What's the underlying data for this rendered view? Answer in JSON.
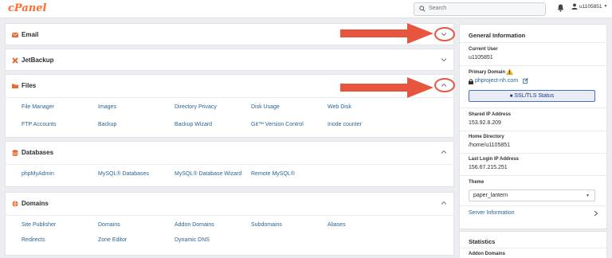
{
  "topbar": {
    "logo": "cPanel",
    "search_placeholder": "Search",
    "username": "u1105851"
  },
  "panels": [
    {
      "title": "Email",
      "icon": "envelope-icon",
      "expanded": false,
      "links": []
    },
    {
      "title": "JetBackup",
      "icon": "jetbackup-icon",
      "expanded": false,
      "links": []
    },
    {
      "title": "Files",
      "icon": "folder-icon",
      "expanded": true,
      "links": [
        "File Manager",
        "Images",
        "Directory Privacy",
        "Disk Usage",
        "Web Disk",
        "FTP Accounts",
        "Backup",
        "Backup Wizard",
        "Git™ Version Control",
        "Inode counter"
      ]
    },
    {
      "title": "Databases",
      "icon": "database-icon",
      "expanded": true,
      "links": [
        "phpMyAdmin",
        "MySQL® Databases",
        "MySQL® Database Wizard",
        "Remote MySQL®"
      ]
    },
    {
      "title": "Domains",
      "icon": "globe-icon",
      "expanded": true,
      "links": [
        "Site Publisher",
        "Domains",
        "Addon Domains",
        "Subdomains",
        "Aliases",
        "Redirects",
        "Zone Editor",
        "Dynamic DNS"
      ]
    }
  ],
  "sidebar": {
    "title": "General Information",
    "current_user_label": "Current User",
    "current_user": "u1105851",
    "primary_domain_label": "Primary Domain",
    "primary_domain": "phproject-nh.com",
    "ssl_button": "SSL/TLS Status",
    "shared_ip_label": "Shared IP Address",
    "shared_ip": "153.92.8.209",
    "home_dir_label": "Home Directory",
    "home_dir": "/home/u1105851",
    "last_login_label": "Last Login IP Address",
    "last_login": "156.67.215.251",
    "theme_label": "Theme",
    "theme": "paper_lantern",
    "server_info": "Server Information"
  },
  "statistics": {
    "title": "Statistics",
    "addon_domains_label": "Addon Domains"
  },
  "colors": {
    "brand": "#ff6c2c",
    "link": "#2a6496",
    "annotation": "#e8553e"
  }
}
